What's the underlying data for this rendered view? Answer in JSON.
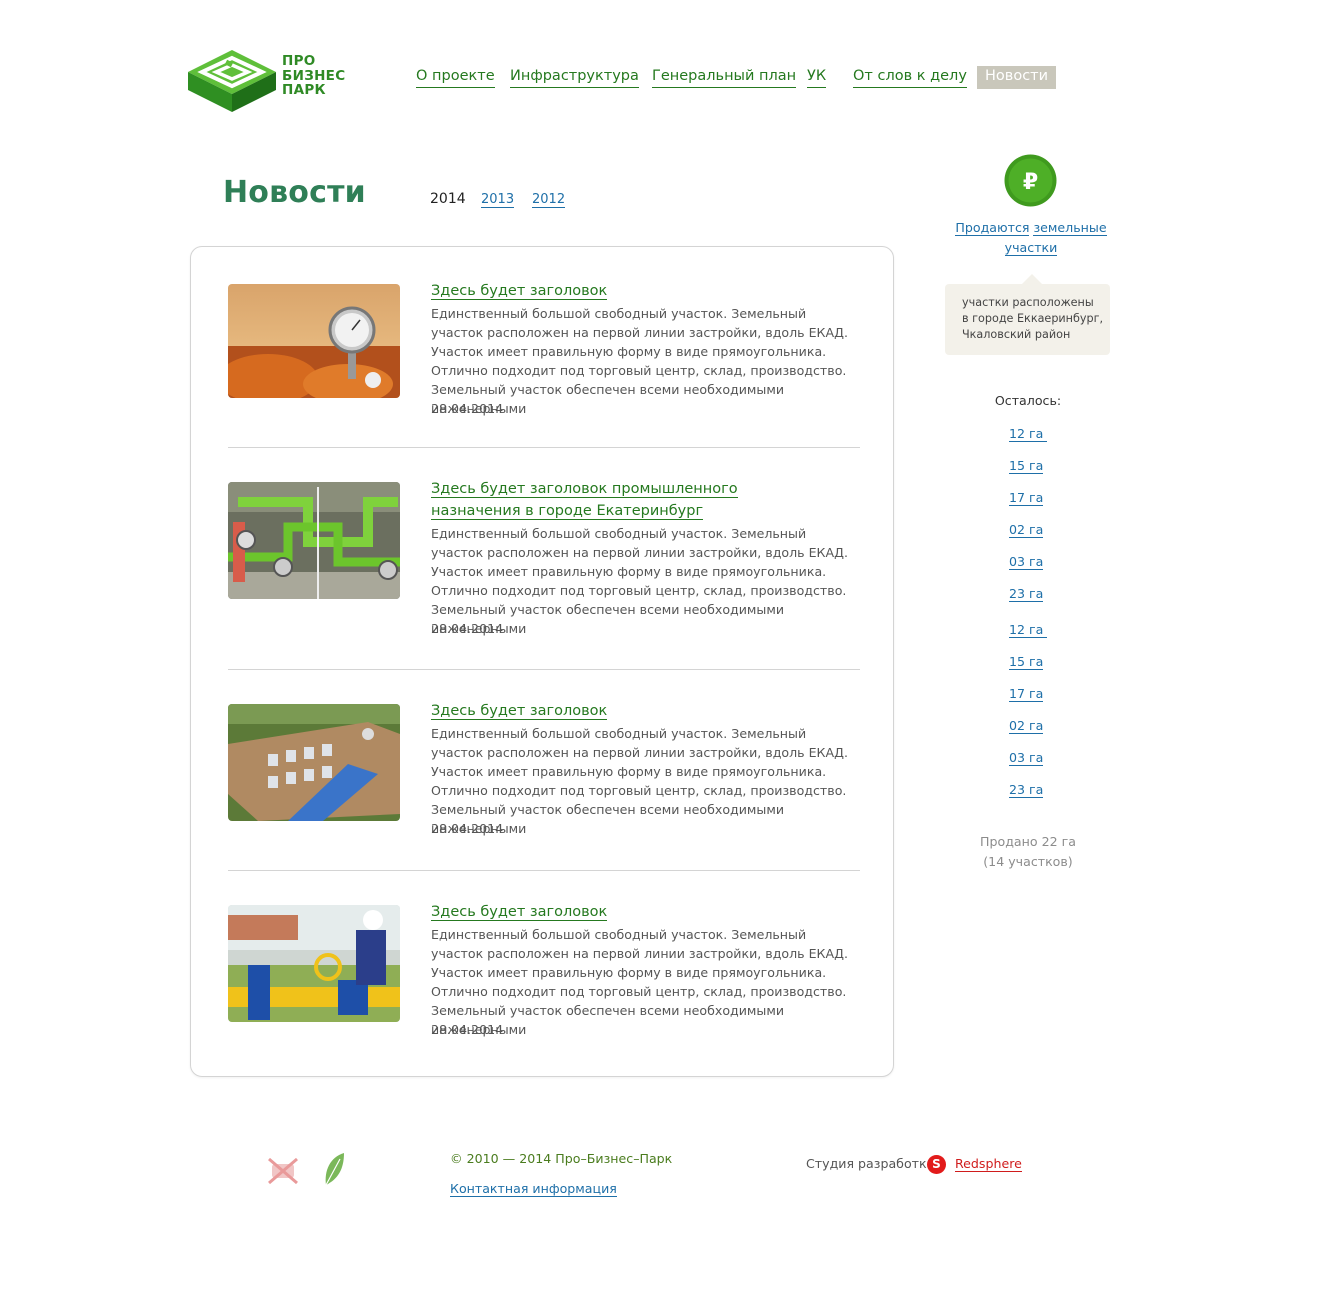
{
  "logo": {
    "line1": "ПРО",
    "line2": "БИЗНЕС",
    "line3": "ПАРК"
  },
  "nav": [
    {
      "label": "О проекте",
      "active": false
    },
    {
      "label": "Инфраструктура",
      "active": false
    },
    {
      "label": "Генеральный план",
      "active": false
    },
    {
      "label": "УК",
      "active": false
    },
    {
      "label": "От слов к делу",
      "active": false
    },
    {
      "label": "Новости",
      "active": true
    }
  ],
  "page": {
    "title": "Новости",
    "years": {
      "current": "2014",
      "links": [
        "2013",
        "2012"
      ]
    }
  },
  "news": [
    {
      "image": "pressure-gauge-photo",
      "title": "Здесь будет заголовок",
      "text": "Единственный большой свободный участок. Земельный участок расположен на первой линии застройки, вдоль ЕКАД. Участок имеет правильную форму в виде прямоугольника. Отлично подходит под торговый центр, склад, производство. Земельный участок обеспечен всеми необходимыми инженерными",
      "date": "28.04.2014"
    },
    {
      "image": "green-pipes-photo",
      "title": "Здесь будет заголовок промышленного назначения в городе Екатеринбург",
      "text": "Единственный большой свободный участок. Земельный участок расположен на первой линии застройки, вдоль ЕКАД. Участок имеет правильную форму в виде прямоугольника. Отлично подходит под торговый центр, склад, производство. Земельный участок обеспечен всеми необходимыми инженерными",
      "date": "28.04.2014"
    },
    {
      "image": "industrial-site-aerial-photo",
      "title": "Здесь будет заголовок",
      "text": "Единственный большой свободный участок. Земельный участок расположен на первой линии застройки, вдоль ЕКАД. Участок имеет правильную форму в виде прямоугольника. Отлично подходит под торговый центр, склад, производство. Земельный участок обеспечен всеми необходимыми инженерными",
      "date": "28.04.2014"
    },
    {
      "image": "gas-worker-photo",
      "title": "Здесь будет заголовок",
      "text": "Единственный большой свободный участок. Земельный участок расположен на первой линии застройки, вдоль ЕКАД. Участок имеет правильную форму в виде прямоугольника. Отлично подходит под торговый центр, склад, производство. Земельный участок обеспечен всеми необходимыми инженерными",
      "date": "28.04.2014"
    }
  ],
  "sidebar": {
    "currency_icon": "ruble-icon",
    "sale_word1": "Продаются",
    "sale_word2": "земельные участки",
    "tooltip": [
      "участки расположены",
      "в городе Еккаеринбург,",
      "Чкаловский район"
    ],
    "remaining_label": "Осталось:",
    "areas": [
      "12 га ",
      "15 га",
      "17 га",
      "02 га",
      "03 га",
      "23 га",
      "12 га ",
      "15 га",
      "17 га",
      "02 га",
      "03 га",
      "23 га"
    ],
    "sold_line1": "Продано 22 га",
    "sold_line2": "(14 участков)"
  },
  "footer": {
    "copyright": "© 2010 — 2014 Про–Бизнес–Парк",
    "contact": "Контактная информация",
    "studio_label": "Студия разработк",
    "studio_icon_letter": "S",
    "studio_name": "Redsphere"
  },
  "colors": {
    "brand_green": "#2f8a25",
    "link_blue": "#1e6fa8",
    "nav_active_bg": "#c9c7bb",
    "studio_red": "#e21b1b"
  }
}
